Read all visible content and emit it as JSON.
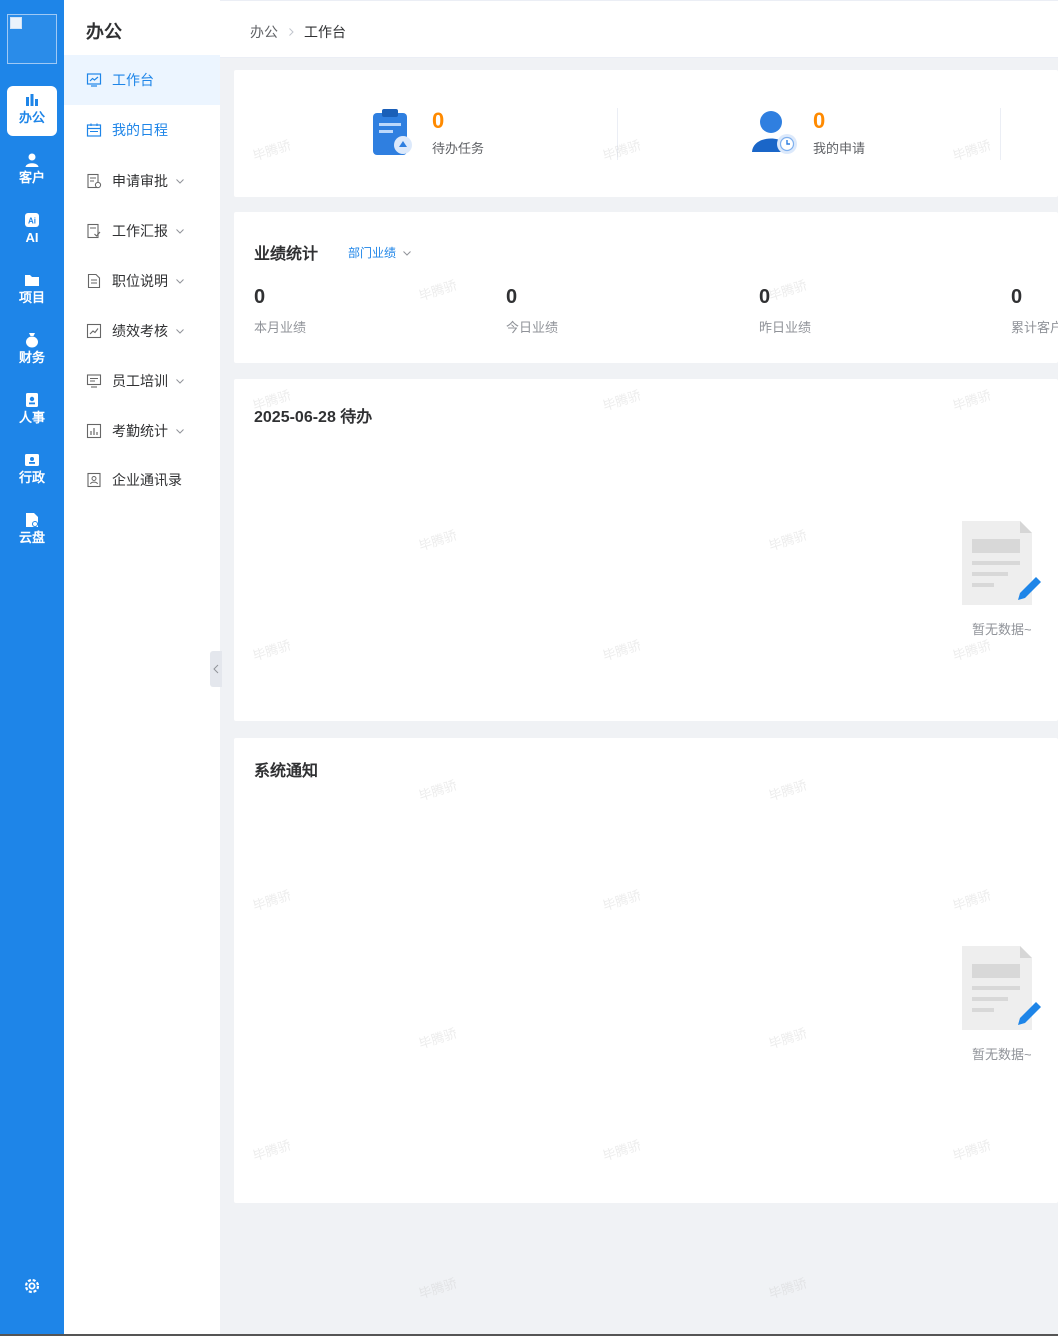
{
  "rail": {
    "items": [
      {
        "label": "办公",
        "icon": "office-icon",
        "active": true
      },
      {
        "label": "客户",
        "icon": "customer-icon"
      },
      {
        "label": "AI",
        "icon": "ai-icon"
      },
      {
        "label": "项目",
        "icon": "project-folder-icon"
      },
      {
        "label": "财务",
        "icon": "finance-icon"
      },
      {
        "label": "人事",
        "icon": "hr-badge-icon"
      },
      {
        "label": "行政",
        "icon": "admin-card-icon"
      },
      {
        "label": "云盘",
        "icon": "cloud-disk-icon"
      }
    ],
    "settings_icon": "gear-icon"
  },
  "submenu": {
    "title": "办公",
    "items": [
      {
        "label": "工作台",
        "icon": "monitor-icon"
      },
      {
        "label": "我的日程",
        "icon": "calendar-icon"
      },
      {
        "label": "申请审批",
        "icon": "approval-doc-icon"
      },
      {
        "label": "工作汇报",
        "icon": "report-doc-icon"
      },
      {
        "label": "职位说明",
        "icon": "position-doc-icon"
      },
      {
        "label": "绩效考核",
        "icon": "performance-chart-icon"
      },
      {
        "label": "员工培训",
        "icon": "training-screen-icon"
      },
      {
        "label": "考勤统计",
        "icon": "attendance-chart-icon"
      },
      {
        "label": "企业通讯录",
        "icon": "contacts-icon"
      }
    ]
  },
  "breadcrumb": {
    "root": "办公",
    "current": "工作台"
  },
  "tasks": [
    {
      "value": "0",
      "label": "待办任务",
      "icon": "clipboard-task-icon"
    },
    {
      "value": "0",
      "label": "我的申请",
      "icon": "user-clock-icon"
    }
  ],
  "performance": {
    "title": "业绩统计",
    "scope": "部门业绩",
    "stats": [
      {
        "value": "0",
        "label": "本月业绩"
      },
      {
        "value": "0",
        "label": "今日业绩"
      },
      {
        "value": "0",
        "label": "昨日业绩"
      },
      {
        "value": "0",
        "label": "累计客户"
      }
    ]
  },
  "todo": {
    "title": "2025-06-28 待办",
    "empty": "暂无数据~"
  },
  "notice": {
    "title": "系统通知",
    "empty": "暂无数据~"
  },
  "watermark": "毕腾骄",
  "colors": {
    "primary": "#1e85e8",
    "accent": "#ff8a00"
  }
}
